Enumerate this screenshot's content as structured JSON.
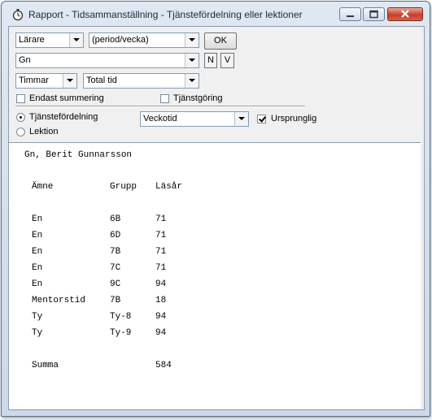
{
  "window": {
    "title": "Rapport - Tidsammanställning - Tjänstefördelning eller lektioner"
  },
  "controls": {
    "type_select": "Lärare",
    "period_select": "(period/vecka)",
    "ok_label": "OK",
    "entity_input": "Gn",
    "n_label": "N",
    "v_label": "V",
    "unit_select": "Timmar",
    "time_select": "Total tid",
    "summary_only_label": "Endast summering",
    "service_label": "Tjänstgöring",
    "radio_distribution_label": "Tjänstefördelning",
    "radio_lesson_label": "Lektion",
    "weektime_select": "Veckotid",
    "original_label": "Ursprunglig"
  },
  "report": {
    "header": "Gn, Berit Gunnarsson",
    "columns": [
      "Ämne",
      "Grupp",
      "Läsår"
    ],
    "rows": [
      [
        "En",
        "6B",
        "71"
      ],
      [
        "En",
        "6D",
        "71"
      ],
      [
        "En",
        "7B",
        "71"
      ],
      [
        "En",
        "7C",
        "71"
      ],
      [
        "En",
        "9C",
        "94"
      ],
      [
        "Mentorstid",
        "7B",
        "18"
      ],
      [
        "Ty",
        "Ty-8",
        "94"
      ],
      [
        "Ty",
        "Ty-9",
        "94"
      ]
    ],
    "sum_label": "Summa",
    "sum_value": "584"
  }
}
